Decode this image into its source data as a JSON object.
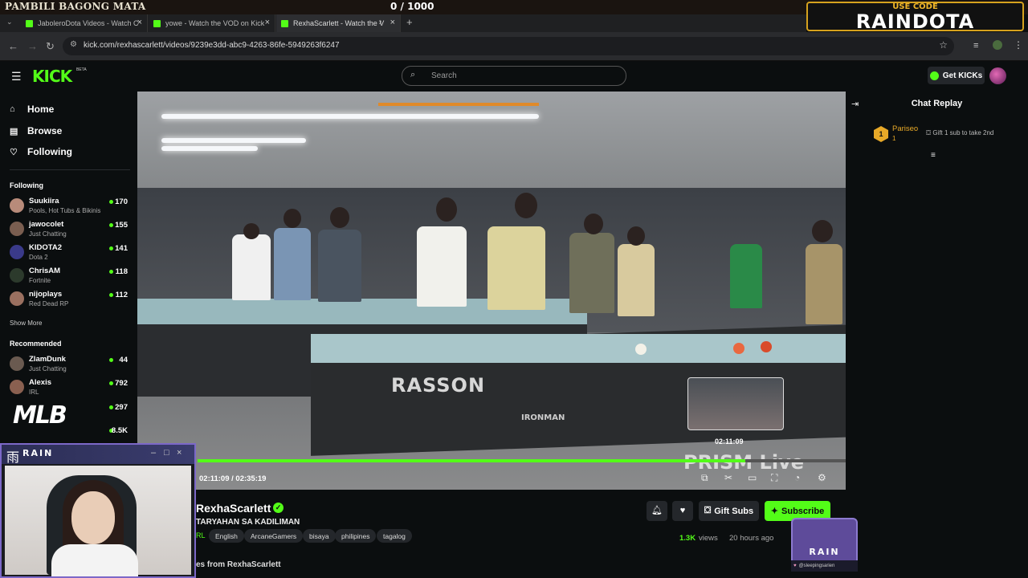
{
  "overlay": {
    "banner_text": "PAMBILI BAGONG MATA",
    "progress_count": "0  / 1000",
    "code_label": "USE CODE",
    "code_value": "RAINDOTA"
  },
  "browser": {
    "tabs": [
      {
        "label": "JaboleroDota Videos - Watch C"
      },
      {
        "label": "yowe - Watch the VOD on Kick"
      },
      {
        "label": "RexhaScarlett - Watch the V"
      }
    ],
    "url": "kick.com/rexhascarlett/videos/9239e3dd-abc9-4263-86fe-5949263f6247"
  },
  "header": {
    "logo": "KICK",
    "logo_badge": "BETA",
    "search_placeholder": "Search",
    "get_kicks": "Get KICKs"
  },
  "sidebar": {
    "nav": [
      {
        "label": "Home",
        "icon": "home-icon"
      },
      {
        "label": "Browse",
        "icon": "browse-icon"
      },
      {
        "label": "Following",
        "icon": "heart-icon"
      }
    ],
    "following_heading": "Following",
    "following": [
      {
        "name": "Suukiira",
        "category": "Pools, Hot Tubs & Bikinis",
        "viewers": "170"
      },
      {
        "name": "jawocolet",
        "category": "Just Chatting",
        "viewers": "155"
      },
      {
        "name": "KIDOTA2",
        "category": "Dota 2",
        "viewers": "141"
      },
      {
        "name": "ChrisAM",
        "category": "Fortnite",
        "viewers": "118"
      },
      {
        "name": "nijoplays",
        "category": "Red Dead RP",
        "viewers": "112"
      }
    ],
    "show_more": "Show More",
    "recommended_heading": "Recommended",
    "recommended": [
      {
        "name": "ZlamDunk",
        "category": "Just Chatting",
        "viewers": "44"
      },
      {
        "name": "Alexis",
        "category": "IRL",
        "viewers": "792"
      },
      {
        "name": "",
        "category": "",
        "viewers": "297"
      },
      {
        "name": "",
        "category": "",
        "viewers": "8.5K"
      }
    ],
    "mlbb_logo": "MLB"
  },
  "video": {
    "table_brand": "RASSON",
    "table_model": "IRONMAN",
    "watermark": "PRISM Live",
    "hover_time": "02:11:09",
    "time_display": "02:11:09 / 02:35:19",
    "progress_fraction": 0.845
  },
  "chat": {
    "title": "Chat Replay",
    "gifter_rank": "1",
    "gifter_name": "Pariseo",
    "gifter_count": "1",
    "gift_message": "Gift 1 sub to take 2nd"
  },
  "channel": {
    "name": "RexhaScarlett",
    "title": "TARYAHAN SA KADILIMAN",
    "category": "RL",
    "tags": [
      "English",
      "ArcaneGamers",
      "bisaya",
      "philipines",
      "tagalog"
    ],
    "gift_subs": "Gift Subs",
    "subscribe": "Subscribe",
    "views_count": "1.3K",
    "views_label": "views",
    "time_ago": "20 hours ago",
    "more_from": "es from RexhaScarlett"
  },
  "webcam": {
    "brand": "RAIN",
    "kanji": "雨"
  },
  "rain_badge": {
    "label": "RAIN",
    "social": "@sleepingsarien"
  },
  "colors": {
    "kick_green": "#53fc18",
    "background": "#0b0e0f",
    "accent_gold": "#e8a928",
    "rain_purple": "#7c68c8"
  }
}
